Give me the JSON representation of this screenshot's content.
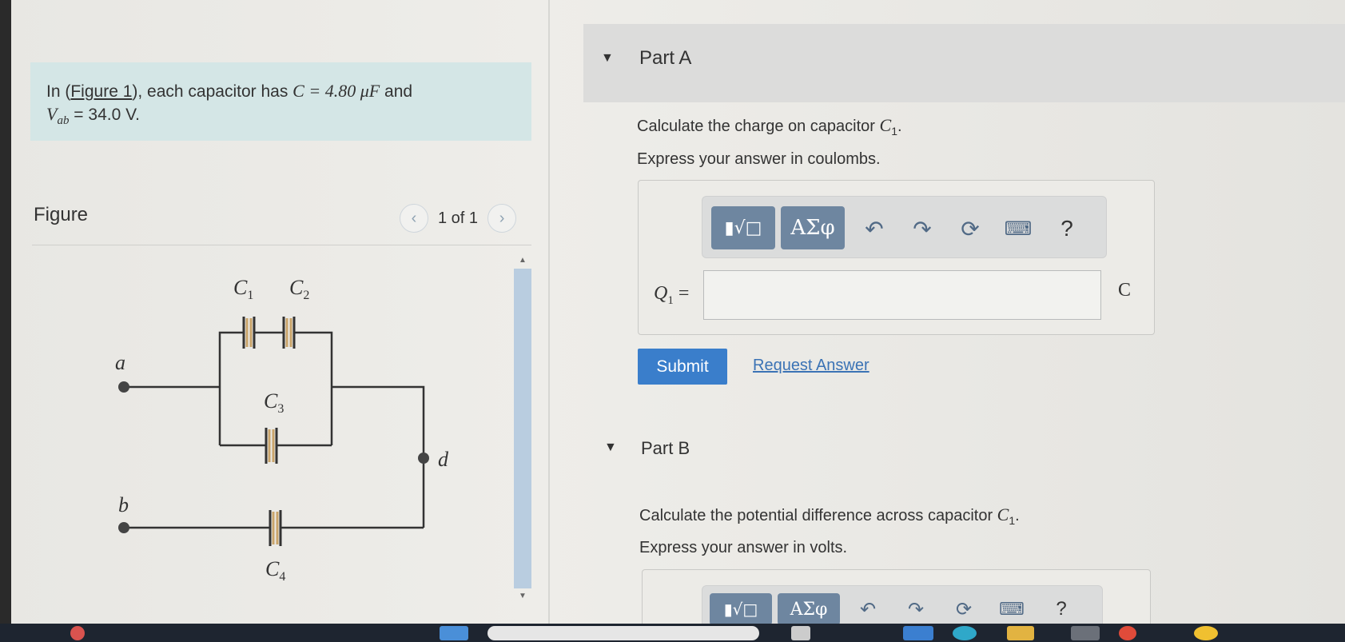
{
  "problem": {
    "intro": "In (",
    "figure_link": "Figure 1",
    "mid": "), each capacitor has ",
    "c_expr": "C = 4.80 μF",
    "and": " and",
    "v_expr": "V",
    "v_sub": "ab",
    "v_value": " = 34.0 V."
  },
  "figure": {
    "label": "Figure",
    "pager": "1 of 1",
    "prev_icon": "chevron-left-icon",
    "next_icon": "chevron-right-icon",
    "labels": {
      "a": "a",
      "b": "b",
      "d": "d",
      "c1": "C",
      "c1_sub": "1",
      "c2": "C",
      "c2_sub": "2",
      "c3": "C",
      "c3_sub": "3",
      "c4": "C",
      "c4_sub": "4"
    }
  },
  "partA": {
    "title": "Part A",
    "question_pre": "Calculate the charge on capacitor ",
    "question_sym": "C",
    "question_sub": "1",
    "question_post": ".",
    "instruction": "Express your answer in coulombs.",
    "answer_label": "Q",
    "answer_sub": "1",
    "answer_eq": " =",
    "unit": "C",
    "submit": "Submit",
    "request": "Request Answer"
  },
  "toolbar": {
    "templates_icon": "templates-icon",
    "symbols_label": "ΑΣφ",
    "undo_icon": "undo-icon",
    "redo_icon": "redo-icon",
    "reset_icon": "reset-icon",
    "keyboard_icon": "keyboard-icon",
    "help_label": "?"
  },
  "partB": {
    "title": "Part B",
    "question_pre": "Calculate the potential difference across capacitor ",
    "question_sym": "C",
    "question_sub": "1",
    "question_post": ".",
    "instruction": "Express your answer in volts."
  },
  "colors": {
    "problem_bg": "#d4e6e6",
    "tool_button": "#6e86a0",
    "submit": "#3a7ecb",
    "link": "#3b73b5"
  }
}
